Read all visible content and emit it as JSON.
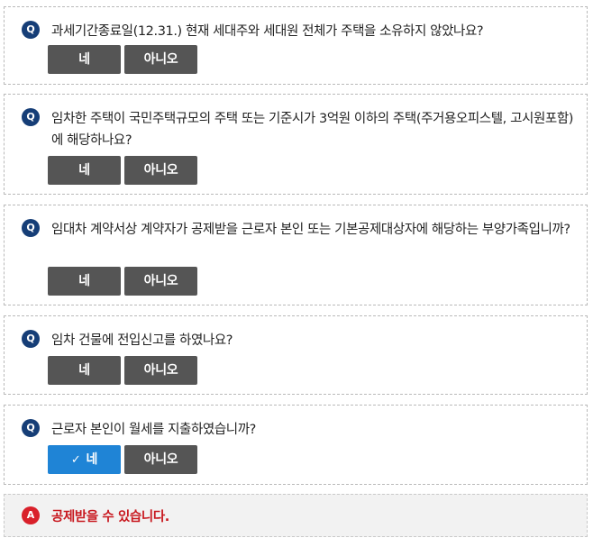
{
  "questions": [
    {
      "badge": "Q",
      "text": "과세기간종료일(12.31.) 현재 세대주와 세대원 전체가 주택을 소유하지 않았나요?",
      "yes": "네",
      "no": "아니오",
      "selected": ""
    },
    {
      "badge": "Q",
      "text": "임차한 주택이 국민주택규모의 주택 또는 기준시가 3억원 이하의 주택(주거용오피스텔, 고시원포함)에 해당하나요?",
      "yes": "네",
      "no": "아니오",
      "selected": ""
    },
    {
      "badge": "Q",
      "text": "임대차 계약서상 계약자가 공제받을 근로자 본인 또는 기본공제대상자에 해당하는 부양가족입니까?",
      "yes": "네",
      "no": "아니오",
      "selected": ""
    },
    {
      "badge": "Q",
      "text": "임차 건물에 전입신고를 하였나요?",
      "yes": "네",
      "no": "아니오",
      "selected": ""
    },
    {
      "badge": "Q",
      "text": "근로자 본인이 월세를 지출하였습니까?",
      "yes": "네",
      "no": "아니오",
      "selected": "yes",
      "check_icon": "✓"
    }
  ],
  "answer": {
    "badge": "A",
    "text": "공제받을 수 있습니다."
  },
  "colors": {
    "q_badge": "#163e77",
    "a_badge": "#d9202a",
    "button": "#555555",
    "button_selected": "#1f84d6",
    "answer_text": "#c8181f"
  }
}
